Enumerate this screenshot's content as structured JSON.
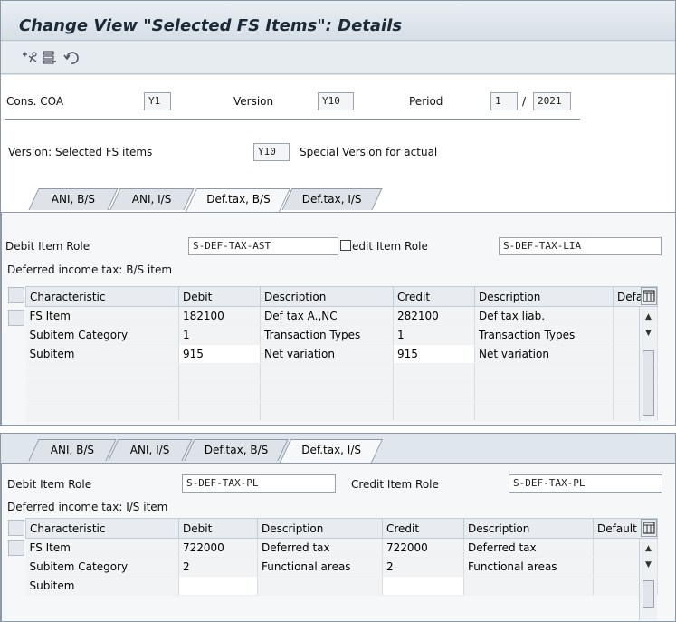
{
  "window": {
    "title": "Change View \"Selected FS Items\": Details"
  },
  "toolbar": {
    "icons": [
      "other-entries-icon",
      "variant-icon",
      "undo-icon"
    ]
  },
  "header": {
    "cons_coa_label": "Cons. COA",
    "cons_coa_value": "Y1",
    "version_label": "Version",
    "version_value": "Y10",
    "period_label": "Period",
    "period_value": "1",
    "period_sep": "/",
    "year_value": "2021"
  },
  "version_row": {
    "label": "Version: Selected FS items",
    "value": "Y10",
    "description": "Special Version for actual"
  },
  "tabs": [
    "ANI, B/S",
    "ANI, I/S",
    "Def.tax, B/S",
    "Def.tax, I/S"
  ],
  "panel1": {
    "active_tab": "Def.tax, B/S",
    "debit_role_label": "Debit Item Role",
    "debit_role_value": "S-DEF-TAX-AST",
    "credit_role_label": "Credit Item Role",
    "credit_role_label_visible": "edit Item Role",
    "credit_role_value": "S-DEF-TAX-LIA",
    "group_title": "Deferred income tax: B/S item",
    "columns": [
      "Characteristic",
      "Debit",
      "Description",
      "Credit",
      "Description",
      "Defa"
    ],
    "rows": [
      [
        "FS Item",
        "182100",
        "Def tax A.,NC",
        "282100",
        "Def tax liab.",
        ""
      ],
      [
        "Subitem Category",
        "1",
        "Transaction Types",
        "1",
        "Transaction Types",
        ""
      ],
      [
        "Subitem",
        "915",
        "Net variation",
        "915",
        "Net variation",
        ""
      ],
      [
        "",
        "",
        "",
        "",
        "",
        ""
      ],
      [
        "",
        "",
        "",
        "",
        "",
        ""
      ],
      [
        "",
        "",
        "",
        "",
        "",
        ""
      ]
    ]
  },
  "panel2": {
    "active_tab": "Def.tax, I/S",
    "debit_role_label": "Debit Item Role",
    "debit_role_value": "S-DEF-TAX-PL",
    "credit_role_label": "Credit Item Role",
    "credit_role_value": "S-DEF-TAX-PL",
    "group_title": "Deferred income tax: I/S item",
    "columns": [
      "Characteristic",
      "Debit",
      "Description",
      "Credit",
      "Description",
      "Default"
    ],
    "rows": [
      [
        "FS Item",
        "722000",
        "Deferred tax",
        "722000",
        "Deferred tax",
        ""
      ],
      [
        "Subitem Category",
        "2",
        "Functional areas",
        "2",
        "Functional areas",
        ""
      ],
      [
        "Subitem",
        "",
        "",
        "",
        "",
        ""
      ]
    ]
  }
}
